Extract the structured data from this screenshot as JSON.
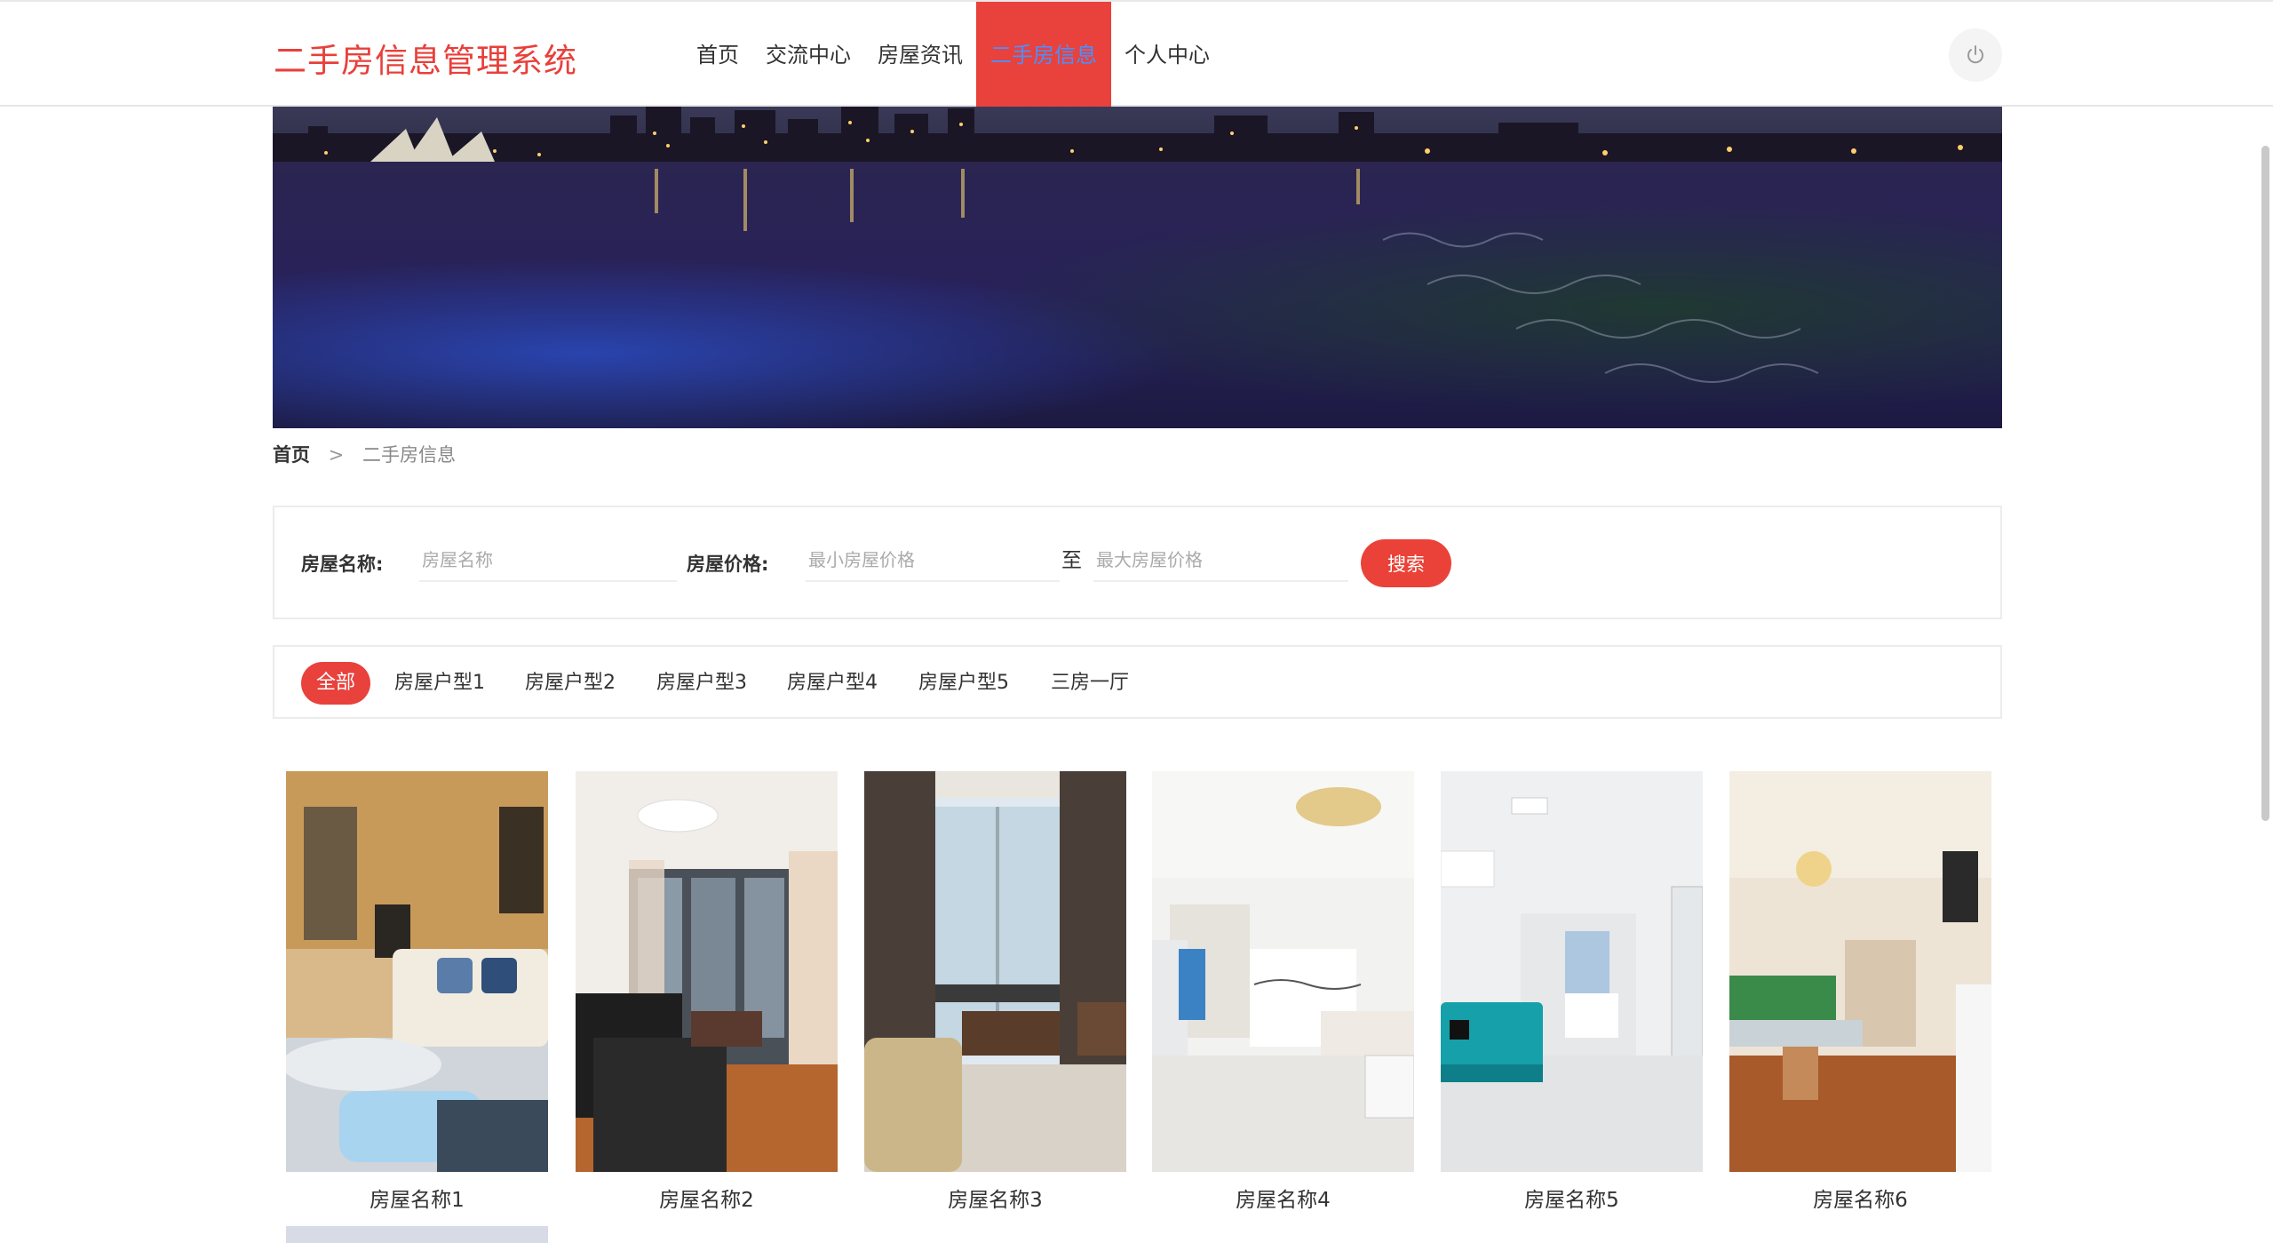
{
  "header": {
    "logo": "二手房信息管理系统",
    "nav": [
      "首页",
      "交流中心",
      "房屋资讯",
      "二手房信息",
      "个人中心"
    ],
    "active_nav": "二手房信息",
    "power_icon": "power-icon"
  },
  "breadcrumb": {
    "home": "首页",
    "separator": ">",
    "current": "二手房信息"
  },
  "search": {
    "name_label": "房屋名称:",
    "name_placeholder": "房屋名称",
    "price_label": "房屋价格:",
    "min_placeholder": "最小房屋价格",
    "to": "至",
    "max_placeholder": "最大房屋价格",
    "button": "搜索"
  },
  "categories": [
    "全部",
    "房屋户型1",
    "房屋户型2",
    "房屋户型3",
    "房屋户型4",
    "房屋户型5",
    "三房一厅"
  ],
  "active_category": "全部",
  "listings": [
    {
      "name": "房屋名称1"
    },
    {
      "name": "房屋名称2"
    },
    {
      "name": "房屋名称3"
    },
    {
      "name": "房屋名称4"
    },
    {
      "name": "房屋名称5"
    },
    {
      "name": "房屋名称6"
    }
  ],
  "colors": {
    "accent": "#e9413c",
    "active_nav_text": "#4a90ff"
  }
}
